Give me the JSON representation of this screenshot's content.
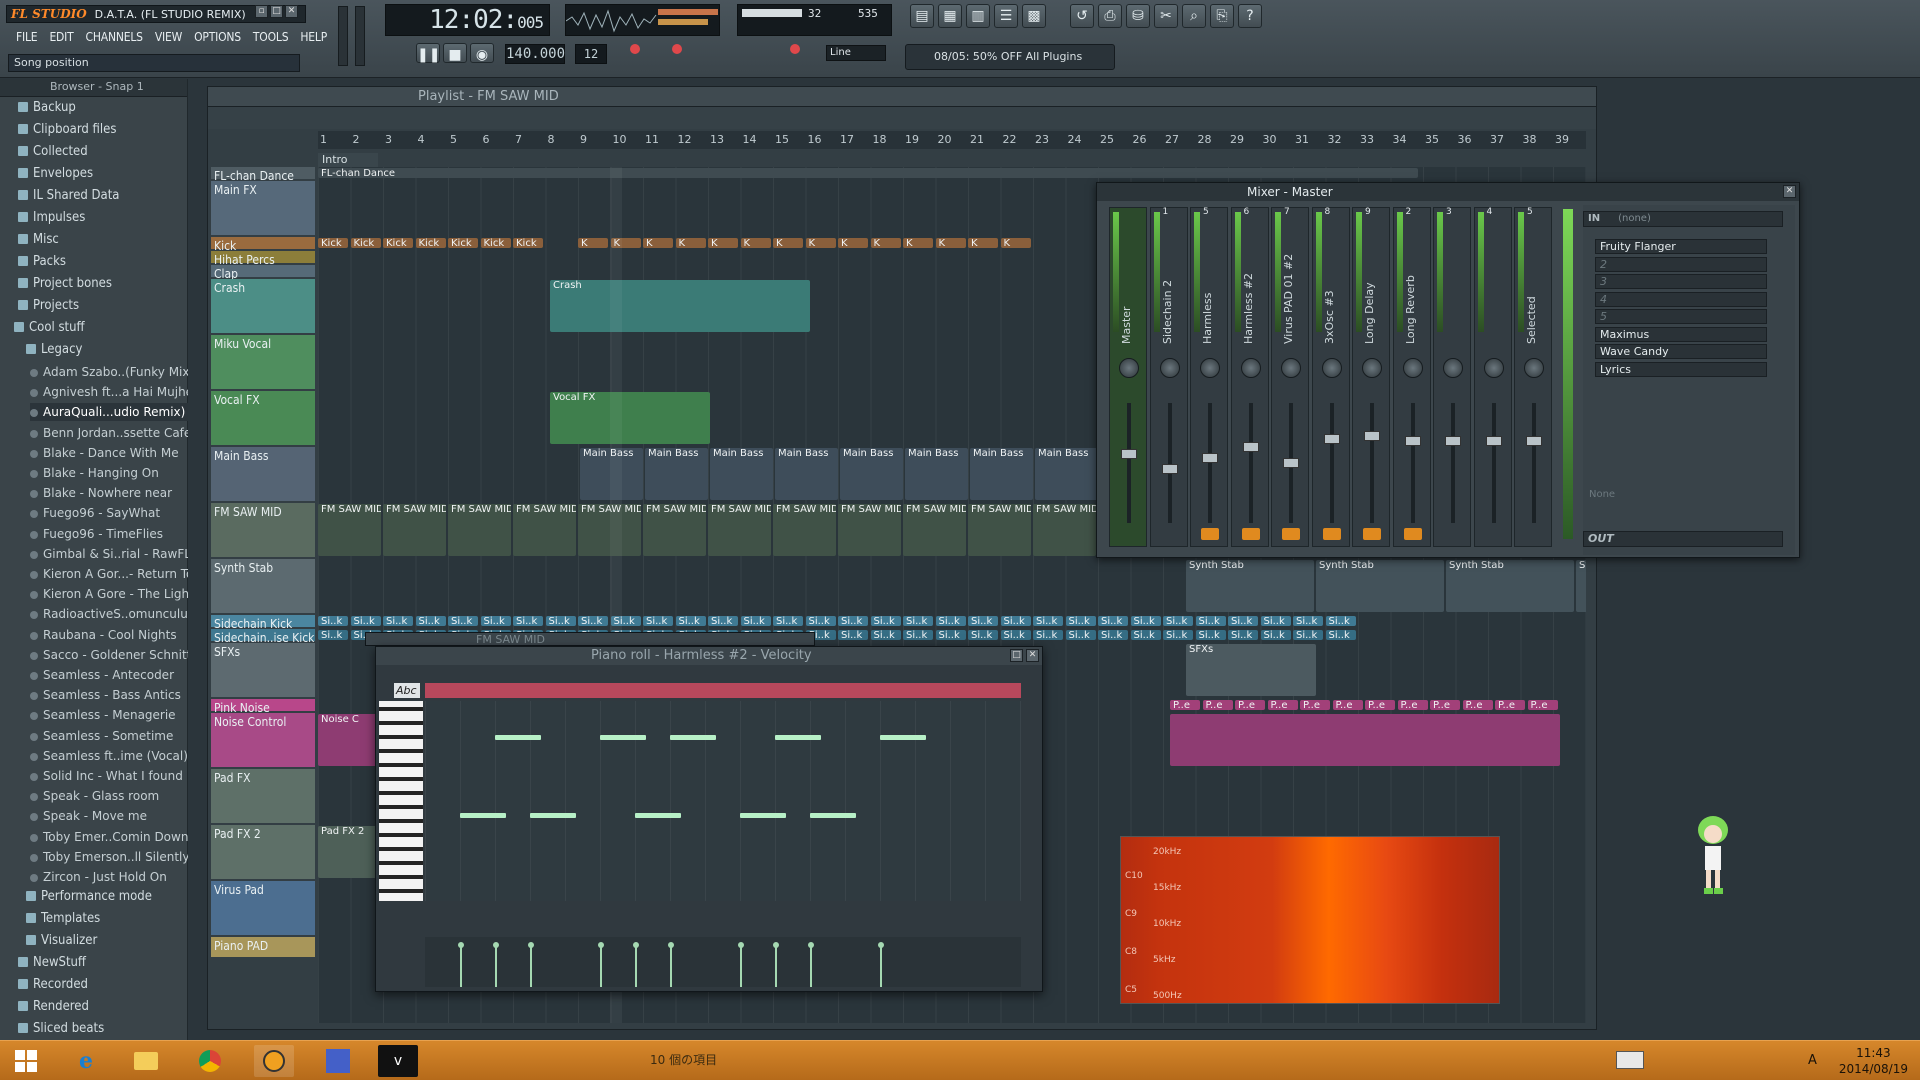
{
  "app": {
    "logo": "FL STUDIO",
    "project_title": "D.A.T.A. (FL STUDIO REMIX)",
    "hint": "Song position"
  },
  "menu": [
    "FILE",
    "EDIT",
    "CHANNELS",
    "VIEW",
    "OPTIONS",
    "TOOLS",
    "HELP"
  ],
  "transport": {
    "time_main": "12:02",
    "time_sub": "005",
    "tempo": "140.000",
    "pattern": "12",
    "cpu": "32",
    "voices": "535",
    "snap": "Line",
    "news": "08/05: 50% OFF All Plugins"
  },
  "browser": {
    "header": "Browser - Snap 1",
    "items": [
      {
        "label": "Backup",
        "type": "folder"
      },
      {
        "label": "Clipboard files",
        "type": "folder"
      },
      {
        "label": "Collected",
        "type": "folder"
      },
      {
        "label": "Envelopes",
        "type": "folder"
      },
      {
        "label": "IL Shared Data",
        "type": "folder"
      },
      {
        "label": "Impulses",
        "type": "folder"
      },
      {
        "label": "Misc",
        "type": "folder"
      },
      {
        "label": "Packs",
        "type": "folder"
      },
      {
        "label": "Project bones",
        "type": "folder"
      },
      {
        "label": "Projects",
        "type": "folder"
      },
      {
        "label": "Cool stuff",
        "type": "folder"
      },
      {
        "label": "Legacy",
        "type": "folder"
      },
      {
        "label": "Adam Szabo..(Funky Mix)",
        "type": "file"
      },
      {
        "label": "Agnivesh ft...a Hai Mujhe",
        "type": "file"
      },
      {
        "label": "AuraQuali...udio Remix)",
        "type": "file"
      },
      {
        "label": "Benn Jordan..ssette Cafe",
        "type": "file"
      },
      {
        "label": "Blake - Dance With Me",
        "type": "file"
      },
      {
        "label": "Blake - Hanging On",
        "type": "file"
      },
      {
        "label": "Blake - Nowhere near",
        "type": "file"
      },
      {
        "label": "Fuego96 - SayWhat",
        "type": "file"
      },
      {
        "label": "Fuego96 - TimeFlies",
        "type": "file"
      },
      {
        "label": "Gimbal & Si..rial - RawFL",
        "type": "file"
      },
      {
        "label": "Kieron A Gor...- Return To",
        "type": "file"
      },
      {
        "label": "Kieron A Gore - The Light",
        "type": "file"
      },
      {
        "label": "RadioactiveS..omunculus",
        "type": "file"
      },
      {
        "label": "Raubana - Cool Nights",
        "type": "file"
      },
      {
        "label": "Sacco - Goldener Schnitt",
        "type": "file"
      },
      {
        "label": "Seamless - Antecoder",
        "type": "file"
      },
      {
        "label": "Seamless - Bass Antics",
        "type": "file"
      },
      {
        "label": "Seamless - Menagerie",
        "type": "file"
      },
      {
        "label": "Seamless - Sometime",
        "type": "file"
      },
      {
        "label": "Seamless ft..ime (Vocal)",
        "type": "file"
      },
      {
        "label": "Solid Inc - What I found",
        "type": "file"
      },
      {
        "label": "Speak - Glass room",
        "type": "file"
      },
      {
        "label": "Speak - Move me",
        "type": "file"
      },
      {
        "label": "Toby Emer..Comin Down",
        "type": "file"
      },
      {
        "label": "Toby Emerson..ll Silently",
        "type": "file"
      },
      {
        "label": "Zircon - Just Hold On",
        "type": "file"
      },
      {
        "label": "Performance mode",
        "type": "folder"
      },
      {
        "label": "Templates",
        "type": "folder"
      },
      {
        "label": "Visualizer",
        "type": "folder"
      },
      {
        "label": "NewStuff",
        "type": "folder"
      },
      {
        "label": "Recorded",
        "type": "folder"
      },
      {
        "label": "Rendered",
        "type": "folder"
      },
      {
        "label": "Sliced beats",
        "type": "folder"
      }
    ]
  },
  "playlist": {
    "title": "Playlist - FM SAW MID",
    "section": "Intro",
    "pattern_name": "FL-chan Dance",
    "ruler": [
      "1",
      "2",
      "3",
      "4",
      "5",
      "6",
      "7",
      "8",
      "9",
      "10",
      "11",
      "12",
      "13",
      "14",
      "15",
      "16",
      "17",
      "18",
      "19",
      "20",
      "21",
      "22",
      "23",
      "24",
      "25",
      "26",
      "27",
      "28",
      "29",
      "30",
      "31",
      "32",
      "33",
      "34",
      "35",
      "36",
      "37",
      "38",
      "39"
    ],
    "tracks": [
      {
        "name": "FL-chan Dance",
        "color": "#4f5c63",
        "h": 12
      },
      {
        "name": "Main FX",
        "color": "#56697a",
        "h": 54
      },
      {
        "name": "Kick",
        "color": "#9a6b3e",
        "h": 12
      },
      {
        "name": "Hihat Percs",
        "color": "#8c7e3a",
        "h": 12
      },
      {
        "name": "Clap",
        "color": "#566a78",
        "h": 12
      },
      {
        "name": "Crash",
        "color": "#4c8e86",
        "h": 54
      },
      {
        "name": "Miku Vocal",
        "color": "#4f8e5e",
        "h": 54
      },
      {
        "name": "Vocal FX",
        "color": "#4a8a55",
        "h": 54
      },
      {
        "name": "Main Bass",
        "color": "#556474",
        "h": 54
      },
      {
        "name": "FM SAW MID",
        "color": "#5a6b60",
        "h": 54
      },
      {
        "name": "Synth Stab",
        "color": "#5c6a70",
        "h": 54
      },
      {
        "name": "Sidechain Kick",
        "color": "#4b86a0",
        "h": 12
      },
      {
        "name": "Sidechain..ise Kick",
        "color": "#3f7890",
        "h": 12
      },
      {
        "name": "SFXs",
        "color": "#5d6a70",
        "h": 54
      },
      {
        "name": "Pink Noise",
        "color": "#b8478a",
        "h": 12
      },
      {
        "name": "Noise Control",
        "color": "#a84a87",
        "h": 54
      },
      {
        "name": "Pad FX",
        "color": "#5e7068",
        "h": 54
      },
      {
        "name": "Pad FX 2",
        "color": "#5e7068",
        "h": 54
      },
      {
        "name": "Virus Pad",
        "color": "#4c6e90",
        "h": 54
      },
      {
        "name": "Piano PAD",
        "color": "#a8965a",
        "h": 20
      }
    ],
    "clip_labels": {
      "kick": "Kick",
      "crash": "Crash",
      "vocal_fx": "Vocal FX",
      "main_bass": "Main Bass",
      "fm_saw": "FM SAW MID",
      "synth_stab": "Synth Stab",
      "sfxs": "SFXs",
      "pad_fx2": "Pad FX 2",
      "noise": "Noise C",
      "sidechain": "Si..k",
      "pink": "P..e"
    }
  },
  "mixer": {
    "title": "Mixer - Master",
    "strips": [
      "Master",
      "Sidechain 2",
      "Harmless",
      "Harmless #2",
      "Virus PAD 01 #2",
      "3xOsc #3",
      "Long Delay",
      "Long Reverb",
      "",
      "",
      "Selected"
    ],
    "strip_numbers": [
      "",
      "1",
      "5",
      "6",
      "7",
      "8",
      "9",
      "2",
      "3",
      "4",
      "5"
    ],
    "in_label": "IN",
    "in_value": "(none)",
    "out_label": "OUT",
    "fx_slots": [
      "Fruity Flanger",
      "2",
      "3",
      "4",
      "5",
      "Maximus",
      "Wave Candy",
      "Lyrics"
    ],
    "none_label": "None"
  },
  "pianoroll": {
    "title": "Piano roll - Harmless #2",
    "target": "Velocity",
    "abc": "Abc",
    "behind_title": "FM SAW MID"
  },
  "spectrogram": {
    "labels": [
      "20kHz",
      "15kHz",
      "10kHz",
      "5kHz",
      "500Hz"
    ],
    "notes": [
      "C10",
      "C9",
      "C8",
      "C5"
    ]
  },
  "taskbar": {
    "items_count": "10 個の項目",
    "time": "11:43",
    "date": "2014/08/19",
    "ime": "A"
  },
  "colors": {
    "accent_orange": "#ff8a2a",
    "taskbar": "#c87a24",
    "note": "#b7f0c7"
  }
}
